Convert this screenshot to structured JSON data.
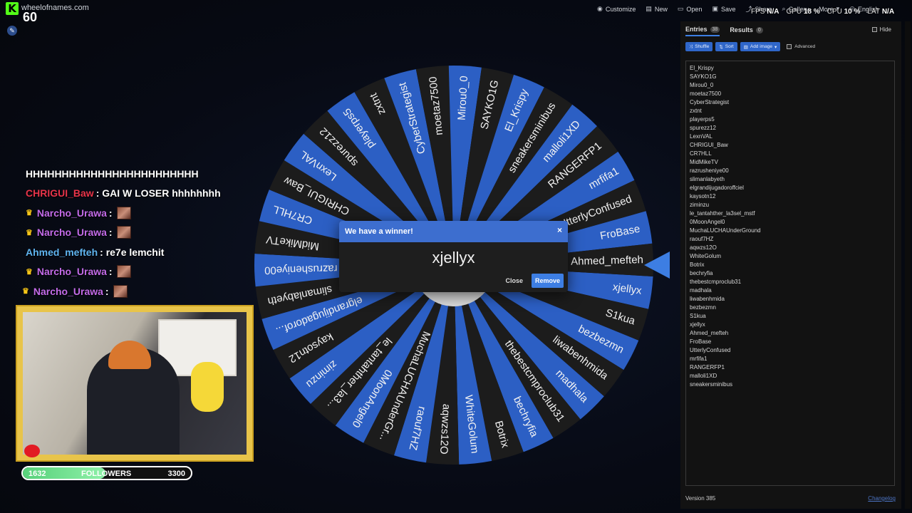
{
  "site": {
    "url": "wheelofnames.com"
  },
  "kick": {
    "logo": "K",
    "number": "60"
  },
  "nav": {
    "items": [
      "Customize",
      "New",
      "Open",
      "Save",
      "Share",
      "Gallery",
      "More",
      "English"
    ]
  },
  "stats": {
    "fps_label": "FPS",
    "fps": "N/A",
    "gpu_label": "GPU",
    "gpu": "18 %",
    "cpu_label": "CPU",
    "cpu": "10 %",
    "lat_label": "LAT",
    "lat": "N/A"
  },
  "chat": [
    {
      "user": "",
      "text": "HHHHHHHHHHHHHHHHHHHHHHHH",
      "color": "#ffffff",
      "crown": false,
      "emote": false
    },
    {
      "user": "CHRIGUI_Baw",
      "text": ": GAI W LOSER hhhhhhhh",
      "color": "#e8344a",
      "crown": false,
      "emote": false
    },
    {
      "user": "Narcho_Urawa",
      "text": ":",
      "color": "#c36be8",
      "crown": true,
      "emote": true
    },
    {
      "user": "Narcho_Urawa",
      "text": ":",
      "color": "#c36be8",
      "crown": true,
      "emote": true
    },
    {
      "user": "Ahmed_mefteh",
      "text": ": re7e lemchit",
      "color": "#5fb4f0",
      "crown": false,
      "emote": false
    },
    {
      "user": "Narcho_Urawa",
      "text": ":",
      "color": "#c36be8",
      "crown": true,
      "emote": true
    },
    {
      "user": "Narcho_Urawa",
      "text": ":",
      "color": "#c36be8",
      "crown": true,
      "emote": true
    }
  ],
  "followers": {
    "current": "1632",
    "label": "FOLLOWERS",
    "goal": "3300",
    "progress": 0.49
  },
  "wheel": {
    "color_a": "#2c5fc4",
    "color_b": "#1c1c1c",
    "slices": [
      "xjellyx",
      "S1kua",
      "bezbezmn",
      "liwabenhmida",
      "madhala",
      "thebestcmproclub31",
      "bechryfia",
      "Botrix",
      "WhiteGolum",
      "aqwzs12O",
      "raouf7HZ",
      "MuchaLUCHAUnderGr...",
      "0MoonAngel0",
      "le_tantahther_la3...",
      "ziminzu",
      "kaysotn12",
      "elgrandijugadorof...",
      "slimanlabyeth",
      "razrusheniye00",
      "MidMikeTV",
      "CR7HLL",
      "CHRIGUI_Baw",
      "LexnVAL",
      "spurezz12",
      "playerps5",
      "zxtnt",
      "CyberStrategist",
      "moetaz7500",
      "Mirou0_0",
      "SAYKO1G",
      "El_Krispy",
      "sneakersminibus",
      "malloli1XD",
      "RANGERFP1",
      "mrfifa1",
      "UtterlyConfused",
      "FroBase",
      "Ahmed_mefteh"
    ]
  },
  "dialog": {
    "title": "We have a winner!",
    "close_x": "×",
    "winner": "xjellyx",
    "close_label": "Close",
    "remove_label": "Remove"
  },
  "panel": {
    "tab_entries": "Entries",
    "entries_count": "38",
    "tab_results": "Results",
    "results_count": "0",
    "hide_label": "Hide",
    "shuffle_label": "Shuffle",
    "sort_label": "Sort",
    "add_image_label": "Add image",
    "advanced_label": "Advanced",
    "entries": [
      "El_Krispy",
      "SAYKO1G",
      "Mirou0_0",
      "moetaz7500",
      "CyberStrategist",
      "zxtnt",
      "playerps5",
      "spurezz12",
      "LexnVAL",
      "CHRIGUI_Baw",
      "CR7HLL",
      "MidMikeTV",
      "razrusheniye00",
      "slimanlabyeth",
      "elgrandijugadoroffciel",
      "kaysotn12",
      "ziminzu",
      "le_tantahther_la3sel_mstf",
      "0MoonAngel0",
      "MuchaLUCHAUnderGround",
      "raouf7HZ",
      "aqwzs12O",
      "WhiteGolum",
      "Botrix",
      "bechryfia",
      "thebestcmproclub31",
      "madhala",
      "liwabenhmida",
      "bezbezmn",
      "S1kua",
      "xjellyx",
      "Ahmed_mefteh",
      "FroBase",
      "UtterlyConfused",
      "mrfifa1",
      "RANGERFP1",
      "malloli1XD",
      "sneakersminibus"
    ],
    "version": "Version 385",
    "changelog": "Changelog"
  }
}
